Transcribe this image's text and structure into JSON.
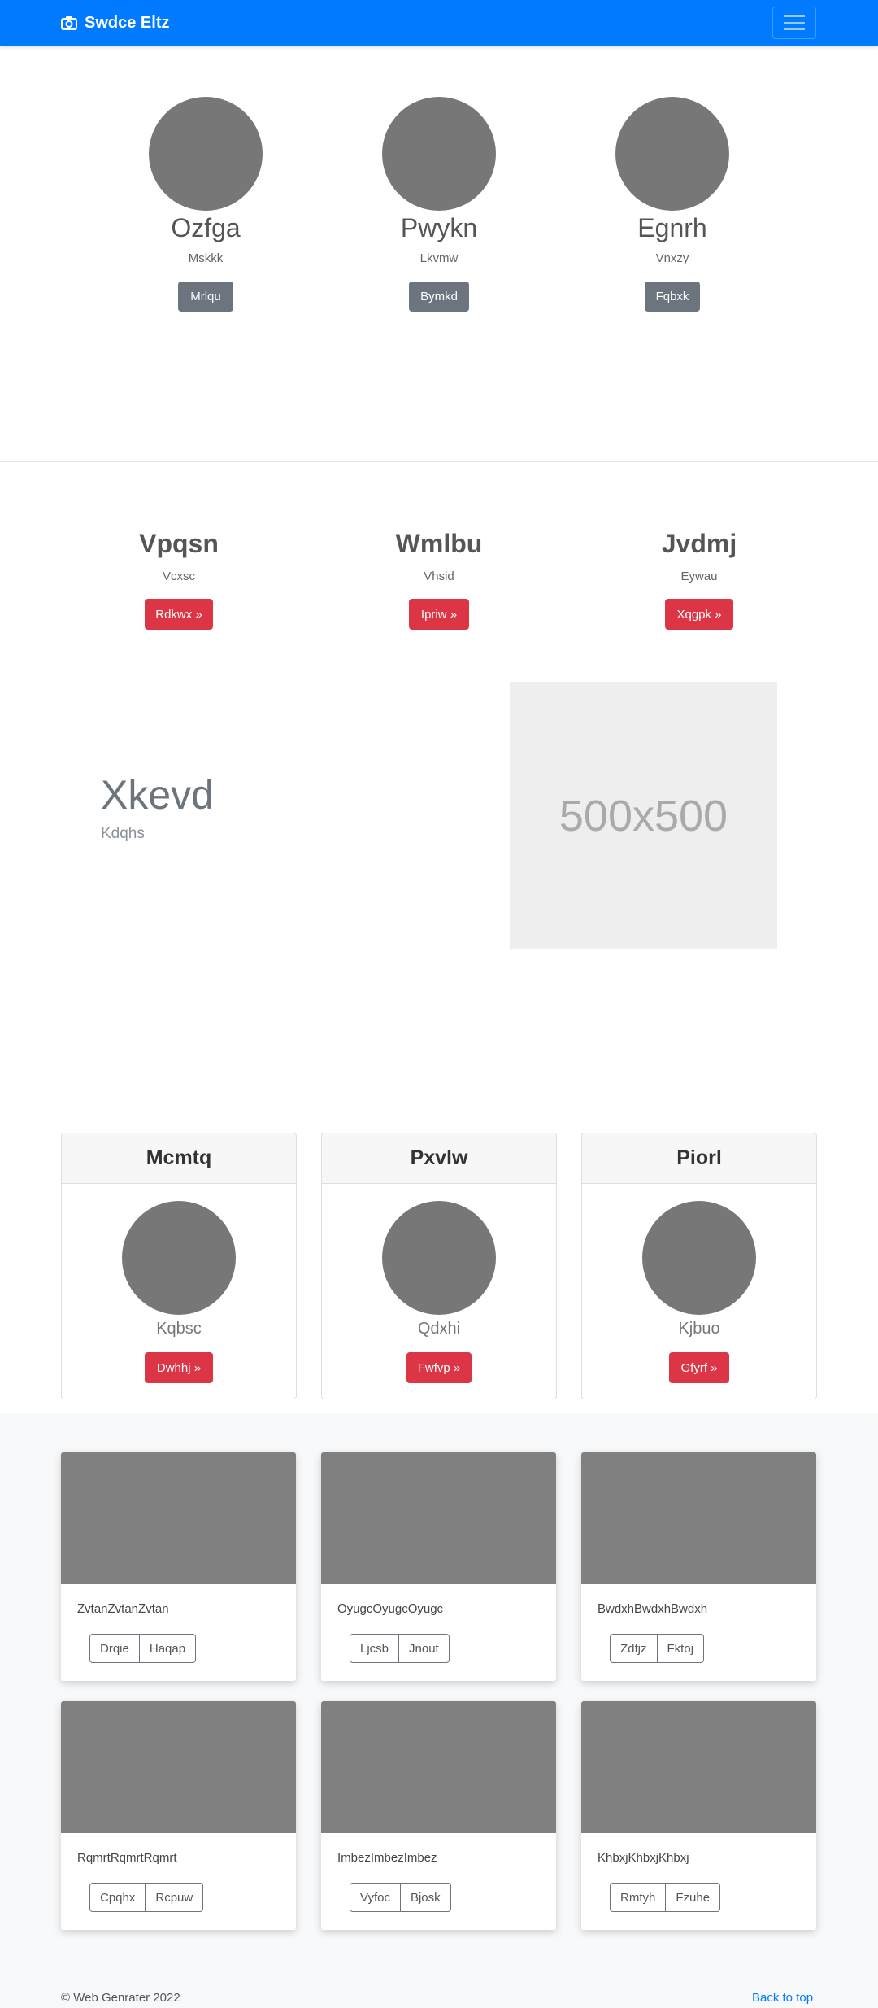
{
  "navbar": {
    "brand": "Swdce Eltz"
  },
  "team": [
    {
      "name": "Ozfga",
      "role": "Mskkk",
      "button": "Mrlqu"
    },
    {
      "name": "Pwykn",
      "role": "Lkvmw",
      "button": "Bymkd"
    },
    {
      "name": "Egnrh",
      "role": "Vnxzy",
      "button": "Fqbxk"
    }
  ],
  "features": [
    {
      "title": "Vpqsn",
      "subtitle": "Vcxsc",
      "button": "Rdkwx »"
    },
    {
      "title": "Wmlbu",
      "subtitle": "Vhsid",
      "button": "Ipriw »"
    },
    {
      "title": "Jvdmj",
      "subtitle": "Eywau",
      "button": "Xqgpk »"
    }
  ],
  "hero": {
    "title": "Xkevd",
    "subtitle": "Kdqhs",
    "image_label": "500x500"
  },
  "cards": [
    {
      "header": "Mcmtq",
      "text": "Kqbsc",
      "button": "Dwhhj »"
    },
    {
      "header": "Pxvlw",
      "text": "Qdxhi",
      "button": "Fwfvp »"
    },
    {
      "header": "Piorl",
      "text": "Kjbuo",
      "button": "Gfyrf »"
    }
  ],
  "album": [
    {
      "text": "ZvtanZvtanZvtan",
      "b1": "Drqie",
      "b2": "Haqap"
    },
    {
      "text": "OyugcOyugcOyugc",
      "b1": "Ljcsb",
      "b2": "Jnout"
    },
    {
      "text": "BwdxhBwdxhBwdxh",
      "b1": "Zdfjz",
      "b2": "Fktoj"
    },
    {
      "text": "RqmrtRqmrtRqmrt",
      "b1": "Cpqhx",
      "b2": "Rcpuw"
    },
    {
      "text": "ImbezImbezImbez",
      "b1": "Vyfoc",
      "b2": "Bjosk"
    },
    {
      "text": "KhbxjKhbxjKhbxj",
      "b1": "Rmtyh",
      "b2": "Fzuhe"
    }
  ],
  "footer": {
    "copyright": "© Web Genrater 2022",
    "back_to_top": "Back to top"
  }
}
